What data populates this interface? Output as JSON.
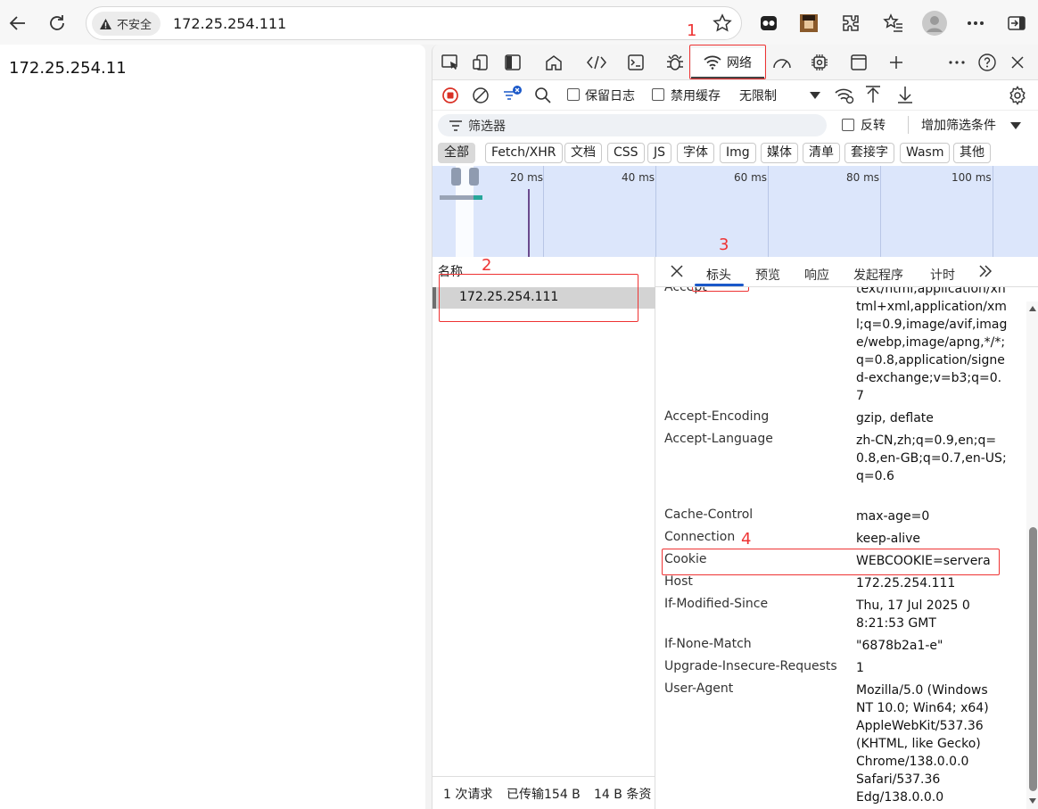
{
  "browser": {
    "insecure_label": "不安全",
    "url": "172.25.254.111"
  },
  "page": {
    "text": "172.25.254.11"
  },
  "devtools": {
    "network_tab_label": "网络",
    "toolbar": {
      "preserve_log": "保留日志",
      "disable_cache": "禁用缓存",
      "throttle": "无限制"
    },
    "filter": {
      "placeholder": "筛选器",
      "invert": "反转",
      "more_filters": "增加筛选条件"
    },
    "types": [
      "全部",
      "Fetch/XHR",
      "文档",
      "CSS",
      "JS",
      "字体",
      "Img",
      "媒体",
      "清单",
      "套接字",
      "Wasm",
      "其他"
    ],
    "timeline_ticks": [
      "20 ms",
      "40 ms",
      "60 ms",
      "80 ms",
      "100 ms"
    ],
    "name_header": "名称",
    "request": "172.25.254.111",
    "status": {
      "requests": "1 次请求",
      "transferred": "已传输154 B",
      "resources": "14 B 条资"
    },
    "detail_tabs": [
      "标头",
      "预览",
      "响应",
      "发起程序",
      "计时"
    ],
    "headers": [
      {
        "key": "Accept",
        "value": "text/html,application/xhtml+xml,application/xml;q=0.9,image/avif,image/webp,image/apng,*/*;q=0.8,application/signed-exchange;v=b3;q=0.7"
      },
      {
        "key": "Accept-Encoding",
        "value": "gzip, deflate"
      },
      {
        "key": "Accept-Language",
        "value": "zh-CN,zh;q=0.9,en;q=0.8,en-GB;q=0.7,en-US;q=0.6"
      },
      {
        "key": "Cache-Control",
        "value": "max-age=0"
      },
      {
        "key": "Connection",
        "value": "keep-alive"
      },
      {
        "key": "Cookie",
        "value": "WEBCOOKIE=servera"
      },
      {
        "key": "Host",
        "value": "172.25.254.111"
      },
      {
        "key": "If-Modified-Since",
        "value": "Thu, 17 Jul 2025 08:21:53 GMT"
      },
      {
        "key": "If-None-Match",
        "value": "\"6878b2a1-e\""
      },
      {
        "key": "Upgrade-Insecure-Requests",
        "value": "1"
      },
      {
        "key": "User-Agent",
        "value": "Mozilla/5.0 (Windows NT 10.0; Win64; x64) AppleWebKit/537.36 (KHTML, like Gecko) Chrome/138.0.0.0 Safari/537.36 Edg/138.0.0.0"
      }
    ]
  },
  "annotations": [
    "1",
    "2",
    "3",
    "4"
  ]
}
